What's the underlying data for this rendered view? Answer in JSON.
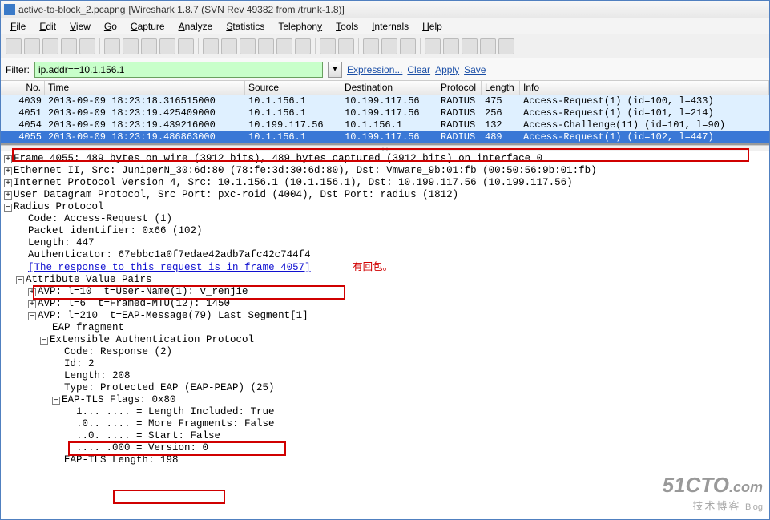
{
  "title": {
    "file": "active-to-block_2.pcapng",
    "app": "[Wireshark 1.8.7  (SVN Rev 49382 from /trunk-1.8)]"
  },
  "menu": [
    "File",
    "Edit",
    "View",
    "Go",
    "Capture",
    "Analyze",
    "Statistics",
    "Telephony",
    "Tools",
    "Internals",
    "Help"
  ],
  "filter": {
    "label": "Filter:",
    "value": "ip.addr==10.1.156.1",
    "links": [
      "Expression...",
      "Clear",
      "Apply",
      "Save"
    ]
  },
  "columns": [
    "No.",
    "Time",
    "Source",
    "Destination",
    "Protocol",
    "Length",
    "Info"
  ],
  "rows": [
    {
      "no": "4039",
      "time": "2013-09-09 18:23:18.316515000",
      "src": "10.1.156.1",
      "dst": "10.199.117.56",
      "proto": "RADIUS",
      "len": "475",
      "info": "Access-Request(1) (id=100, l=433)"
    },
    {
      "no": "4051",
      "time": "2013-09-09 18:23:19.425409000",
      "src": "10.1.156.1",
      "dst": "10.199.117.56",
      "proto": "RADIUS",
      "len": "256",
      "info": "Access-Request(1) (id=101, l=214)"
    },
    {
      "no": "4054",
      "time": "2013-09-09 18:23:19.439216000",
      "src": "10.199.117.56",
      "dst": "10.1.156.1",
      "proto": "RADIUS",
      "len": "132",
      "info": "Access-Challenge(11) (id=101, l=90)"
    },
    {
      "no": "4055",
      "time": "2013-09-09 18:23:19.486863000",
      "src": "10.1.156.1",
      "dst": "10.199.117.56",
      "proto": "RADIUS",
      "len": "489",
      "info": "Access-Request(1) (id=102, l=447)"
    }
  ],
  "tree": {
    "frame": "Frame 4055: 489 bytes on wire (3912 bits), 489 bytes captured (3912 bits) on interface 0",
    "eth": "Ethernet II, Src: JuniperN_30:6d:80 (78:fe:3d:30:6d:80), Dst: Vmware_9b:01:fb (00:50:56:9b:01:fb)",
    "ip": "Internet Protocol Version 4, Src: 10.1.156.1 (10.1.156.1), Dst: 10.199.117.56 (10.199.117.56)",
    "udp": "User Datagram Protocol, Src Port: pxc-roid (4004), Dst Port: radius (1812)",
    "radius": "Radius Protocol",
    "code": "Code: Access-Request (1)",
    "pktid": "Packet identifier: 0x66 (102)",
    "length": "Length: 447",
    "auth": "Authenticator: 67ebbc1a0f7edae42adb7afc42c744f4",
    "resp": "[The response to this request is in frame 4057]",
    "anno_resp": "有回包。",
    "avp_hdr": "Attribute Value Pairs",
    "avp1": "AVP: l=10  t=User-Name(1): v_renjie",
    "avp2": "AVP: l=6  t=Framed-MTU(12): 1450",
    "avp3": "AVP: l=210  t=EAP-Message(79) Last Segment[1]",
    "eapfrag": "EAP fragment",
    "eap": "Extensible Authentication Protocol",
    "eapcode": "Code: Response (2)",
    "eapid": "Id: 2",
    "eaplen": "Length: 208",
    "eaptype": "Type: Protected EAP (EAP-PEAP) (25)",
    "flags": "EAP-TLS Flags: 0x80",
    "f1": "1... .... = Length Included: True",
    "f2": ".0.. .... = More Fragments: False",
    "f3": "..0. .... = Start: False",
    "f4": ".... .000 = Version: 0",
    "tlslen": "EAP-TLS Length: 198"
  },
  "watermark": {
    "big": "51CTO",
    ".com": ".com",
    "sub": "技术博客",
    "blog": "Blog"
  }
}
